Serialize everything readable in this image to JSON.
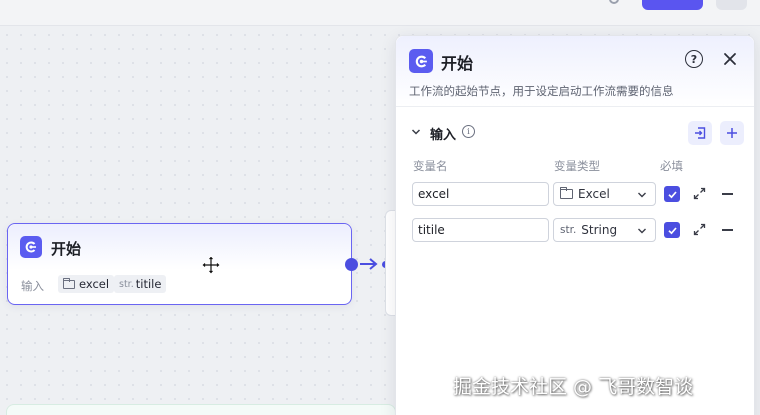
{
  "colors": {
    "accent": "#5b5cf0",
    "node_border": "#6a65f2",
    "edge": "#4b4ee0",
    "canvas_bg": "#eef0f3"
  },
  "canvas": {
    "start_node": {
      "title": "开始",
      "icon": "start-logo-icon",
      "inputs_label": "输入",
      "inputs": [
        {
          "name": "excel",
          "type_icon": "folder-icon"
        },
        {
          "name": "titile",
          "type_tag": "str."
        }
      ]
    }
  },
  "panel": {
    "title": "开始",
    "description": "工作流的起始节点，用于设定启动工作流需要的信息",
    "section": {
      "title": "输入",
      "columns": {
        "name": "变量名",
        "type": "变量类型",
        "required": "必填"
      },
      "rows": [
        {
          "name": "excel",
          "type_icon": "folder-icon",
          "type_label": "Excel",
          "required": true
        },
        {
          "name": "titile",
          "type_tag": "str.",
          "type_label": "String",
          "required": true
        }
      ]
    }
  },
  "watermark": "掘金技术社区 @ 飞哥数智谈"
}
